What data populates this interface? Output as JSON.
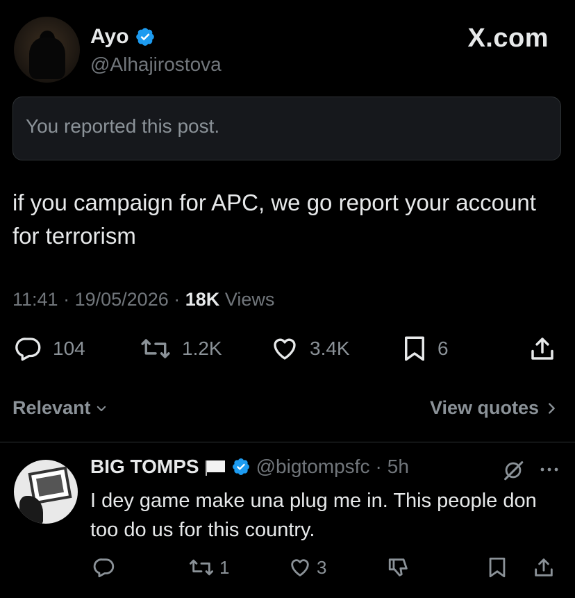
{
  "header": {
    "display_name": "Ayo",
    "handle": "@Alhajirostova",
    "brand": "X.com"
  },
  "notice": {
    "text": "You reported this post."
  },
  "post": {
    "text": "if you campaign for APC, we go report your account for terrorism",
    "time": "11:41",
    "date": "19/05/2026",
    "views_count": "18K",
    "views_label": "Views",
    "separator": "·"
  },
  "actions": {
    "replies": "104",
    "reposts": "1.2K",
    "likes": "3.4K",
    "bookmarks": "6"
  },
  "sort": {
    "relevant_label": "Relevant",
    "view_quotes_label": "View quotes"
  },
  "reply": {
    "display_name": "BIG TOMPS",
    "handle": "@bigtompsfc",
    "separator": "·",
    "time": "5h",
    "text": "I dey game make una plug me in. This people don too do us for this country.",
    "reposts": "1",
    "likes": "3"
  },
  "colors": {
    "background": "#000000",
    "text": "#e7e9ea",
    "muted": "#71767b",
    "verified": "#1d9bf0"
  }
}
